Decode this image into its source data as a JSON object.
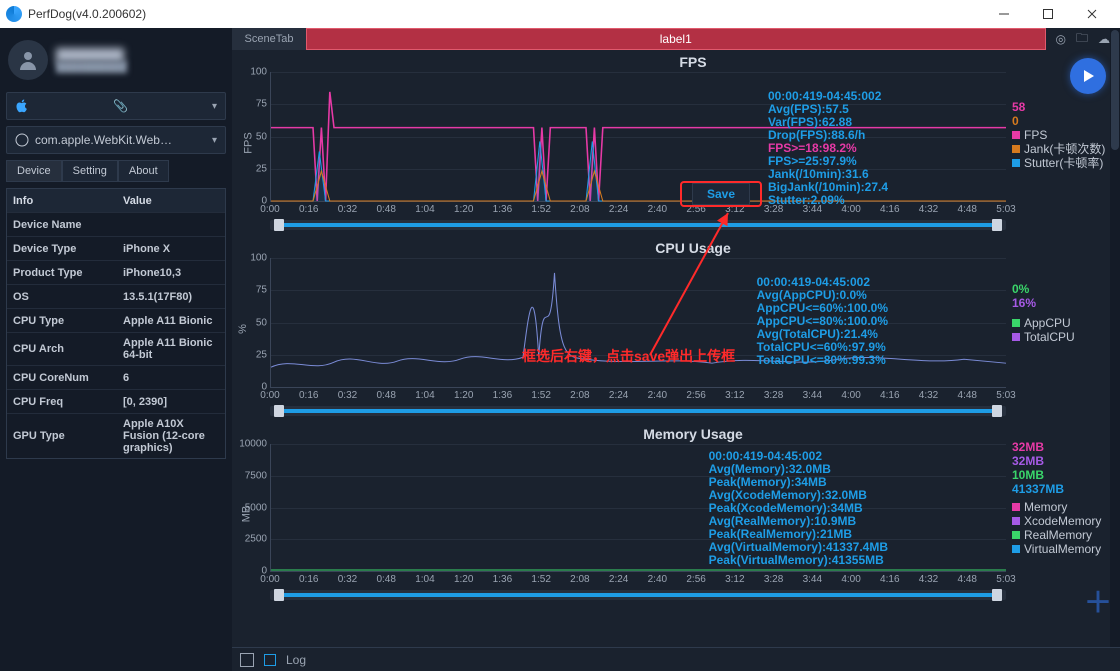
{
  "window": {
    "title": "PerfDog(v4.0.200602)"
  },
  "scene": {
    "tab": "SceneTab",
    "label": "label1"
  },
  "sidebar": {
    "device_selector": {
      "text": ""
    },
    "app_selector": {
      "icon": "safari-icon",
      "text": "com.apple.WebKit.Web…"
    },
    "tabs": [
      "Device",
      "Setting",
      "About"
    ],
    "info_headers": {
      "k": "Info",
      "v": "Value"
    },
    "info": [
      {
        "k": "Device Name",
        "v": ""
      },
      {
        "k": "Device Type",
        "v": "iPhone X"
      },
      {
        "k": "Product Type",
        "v": "iPhone10,3"
      },
      {
        "k": "OS",
        "v": "13.5.1(17F80)"
      },
      {
        "k": "CPU Type",
        "v": "Apple A11 Bionic"
      },
      {
        "k": "CPU Arch",
        "v": "Apple A11 Bionic 64-bit"
      },
      {
        "k": "CPU CoreNum",
        "v": "6"
      },
      {
        "k": "CPU Freq",
        "v": "[0, 2390]"
      },
      {
        "k": "GPU Type",
        "v": "Apple A10X Fusion (12-core graphics)"
      }
    ]
  },
  "annotation": {
    "save": "Save",
    "caption": "框选后右键，点击save弹出上传框"
  },
  "bottom": {
    "log": "Log"
  },
  "xticks": [
    "0:00",
    "0:16",
    "0:32",
    "0:48",
    "1:04",
    "1:20",
    "1:36",
    "1:52",
    "2:08",
    "2:24",
    "2:40",
    "2:56",
    "3:12",
    "3:28",
    "3:44",
    "4:00",
    "4:16",
    "4:32",
    "4:48",
    "5:03"
  ],
  "chart_data": [
    {
      "type": "line",
      "title": "FPS",
      "ylabel": "FPS",
      "ylim": [
        0,
        100
      ],
      "yticks": [
        0,
        25,
        50,
        75,
        100
      ],
      "x_range": [
        "0:00",
        "5:03"
      ],
      "series": [
        {
          "name": "FPS",
          "color": "#e63aa6",
          "current": 58,
          "note": "flat ≈57–60 the whole run with several brief dips to ~0 near 0:16–0:20, 1:28–1:48, and 1:56"
        },
        {
          "name": "Jank(卡顿次数)",
          "color": "#d67a1e",
          "current": 0,
          "note": "baseline 0 with short spikes coinciding with FPS dips"
        },
        {
          "name": "Stutter(卡顿率)",
          "color": "#1e9de6",
          "note": "baseline 0 with short spikes (~20–50) coinciding with FPS dips"
        }
      ],
      "overlay": [
        "00:00:419-04:45:002",
        "Avg(FPS):57.5",
        "Var(FPS):62.88",
        "Drop(FPS):88.6/h",
        "FPS>=18:98.2%",
        "FPS>=25:97.9%",
        "Jank(/10min):31.6",
        "BigJank(/10min):27.4",
        "Stutter:2.09%"
      ],
      "legend": [
        {
          "value": "58",
          "color": "#e63aa6"
        },
        {
          "value": "0",
          "color": "#d67a1e"
        },
        {
          "label": "FPS",
          "sw": "#e63aa6"
        },
        {
          "label": "Jank(卡顿次数)",
          "sw": "#d67a1e"
        },
        {
          "label": "Stutter(卡顿率)",
          "sw": "#1e9de6"
        }
      ]
    },
    {
      "type": "line",
      "title": "CPU Usage",
      "ylabel": "%",
      "ylim": [
        0,
        100
      ],
      "yticks": [
        0,
        25,
        50,
        75,
        100
      ],
      "x_range": [
        "0:00",
        "5:03"
      ],
      "series": [
        {
          "name": "AppCPU",
          "color": "#3ad66a",
          "current": "0%",
          "note": "effectively 0% throughout"
        },
        {
          "name": "TotalCPU",
          "color": "#a65ae6",
          "current": "16%",
          "note": "noisy 10–30% baseline; tall spikes to ~90–100% around 1:30–1:55"
        }
      ],
      "overlay": [
        "00:00:419-04:45:002",
        "Avg(AppCPU):0.0%",
        "AppCPU<=60%:100.0%",
        "AppCPU<=80%:100.0%",
        "Avg(TotalCPU):21.4%",
        "TotalCPU<=60%:97.9%",
        "TotalCPU<=80%:99.3%"
      ],
      "legend": [
        {
          "value": "0%",
          "color": "#3ad66a"
        },
        {
          "value": "16%",
          "color": "#a65ae6"
        },
        {
          "label": "AppCPU",
          "sw": "#3ad66a"
        },
        {
          "label": "TotalCPU",
          "sw": "#a65ae6"
        }
      ]
    },
    {
      "type": "line",
      "title": "Memory Usage",
      "ylabel": "MB",
      "ylim": [
        0,
        10000
      ],
      "yticks": [
        0,
        2500,
        5000,
        7500,
        10000
      ],
      "x_range": [
        "0:00",
        "5:03"
      ],
      "series": [
        {
          "name": "Memory",
          "color": "#e63aa6",
          "current": "32MB",
          "note": "flat ≈32MB"
        },
        {
          "name": "XcodeMemory",
          "color": "#a65ae6",
          "current": "32MB",
          "note": "flat ≈32MB"
        },
        {
          "name": "RealMemory",
          "color": "#3ad66a",
          "current": "10MB",
          "note": "flat ≈11MB"
        },
        {
          "name": "VirtualMemory",
          "color": "#1e9de6",
          "current": "41337MB",
          "note": "off-scale high, drawn clipped at top"
        }
      ],
      "overlay": [
        "00:00:419-04:45:002",
        "Avg(Memory):32.0MB",
        "Peak(Memory):34MB",
        "Avg(XcodeMemory):32.0MB",
        "Peak(XcodeMemory):34MB",
        "Avg(RealMemory):10.9MB",
        "Peak(RealMemory):21MB",
        "Avg(VirtualMemory):41337.4MB",
        "Peak(VirtualMemory):41355MB"
      ],
      "legend": [
        {
          "value": "32MB",
          "color": "#e63aa6"
        },
        {
          "value": "32MB",
          "color": "#a65ae6"
        },
        {
          "value": "10MB",
          "color": "#3ad66a"
        },
        {
          "value": "41337MB",
          "color": "#1e9de6"
        },
        {
          "label": "Memory",
          "sw": "#e63aa6"
        },
        {
          "label": "XcodeMemory",
          "sw": "#a65ae6"
        },
        {
          "label": "RealMemory",
          "sw": "#3ad66a"
        },
        {
          "label": "VirtualMemory",
          "sw": "#1e9de6"
        }
      ]
    }
  ]
}
